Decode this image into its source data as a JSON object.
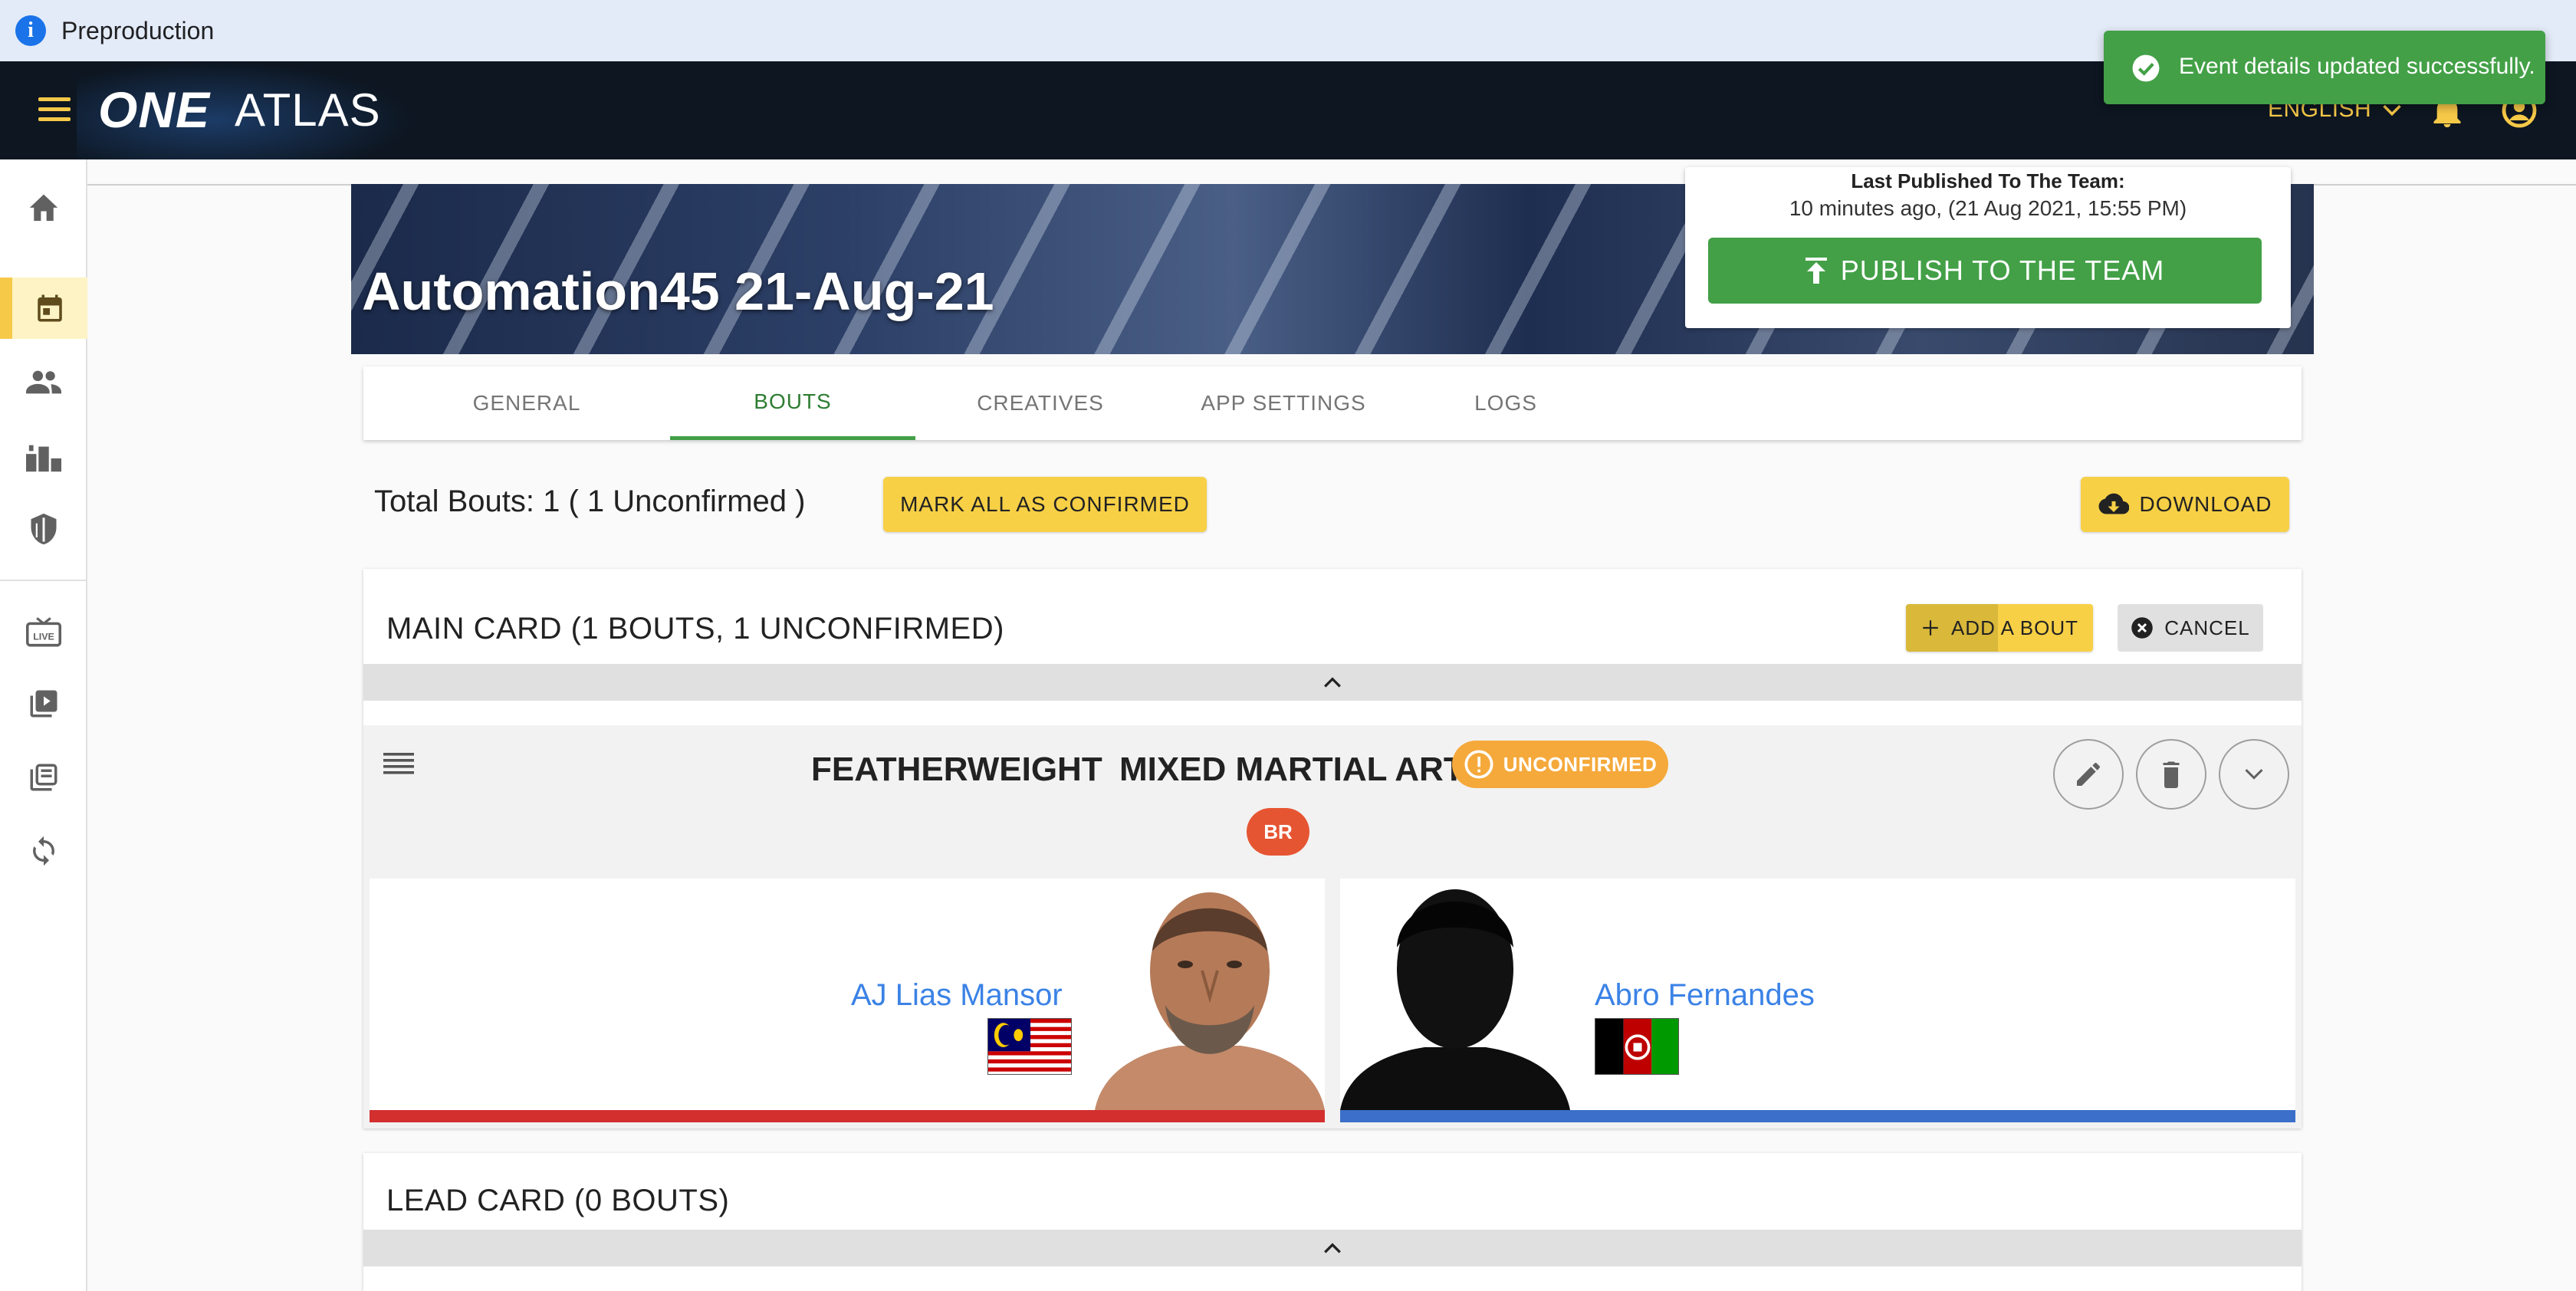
{
  "env": {
    "label": "Preproduction"
  },
  "appbar": {
    "logo_one": "ONE",
    "logo_atlas": "ATLAS",
    "language": "ENGLISH"
  },
  "toast": {
    "message": "Event details updated successfully."
  },
  "sidebar": {
    "items": [
      {
        "icon": "home-icon"
      },
      {
        "icon": "calendar-icon",
        "active": true
      },
      {
        "icon": "people-icon"
      },
      {
        "icon": "podium-icon"
      },
      {
        "icon": "shield-icon"
      },
      {
        "icon": "live-tv-icon"
      },
      {
        "icon": "video-library-icon"
      },
      {
        "icon": "collections-icon"
      },
      {
        "icon": "sync-icon"
      }
    ]
  },
  "event": {
    "title": "Automation45 21-Aug-21",
    "last_published_label": "Last Published To The Team:",
    "last_published_time": "10 minutes ago, (21 Aug 2021, 15:55 PM)",
    "publish_button": "PUBLISH TO THE TEAM"
  },
  "tabs": [
    {
      "label": "GENERAL"
    },
    {
      "label": "BOUTS",
      "active": true
    },
    {
      "label": "CREATIVES"
    },
    {
      "label": "APP SETTINGS"
    },
    {
      "label": "LOGS"
    }
  ],
  "bouts_summary": {
    "total_text": "Total Bouts: 1 ( 1 Unconfirmed )",
    "mark_all_label": "MARK ALL AS CONFIRMED",
    "download_label": "DOWNLOAD"
  },
  "main_card": {
    "heading": "MAIN CARD (1 BOUTS, 1 UNCONFIRMED)",
    "add_bout_label": "ADD A BOUT",
    "cancel_label": "CANCEL",
    "bout": {
      "weight_class": "FEATHERWEIGHT",
      "discipline": "MIXED MARTIAL ARTS",
      "status": "UNCONFIRMED",
      "rule_badge": "BR",
      "red_corner": {
        "name": "AJ Lias Mansor",
        "flag": "Malaysia",
        "color": "#d32f2f"
      },
      "blue_corner": {
        "name": "Abro Fernandes",
        "flag": "Afghanistan",
        "color": "#3b6fc9"
      }
    }
  },
  "lead_card": {
    "heading": "LEAD CARD (0 BOUTS)"
  },
  "colors": {
    "accent_yellow": "#f7d046",
    "success_green": "#43a047",
    "warning_orange": "#f5a93b",
    "appbar_dark": "#0d1621"
  }
}
